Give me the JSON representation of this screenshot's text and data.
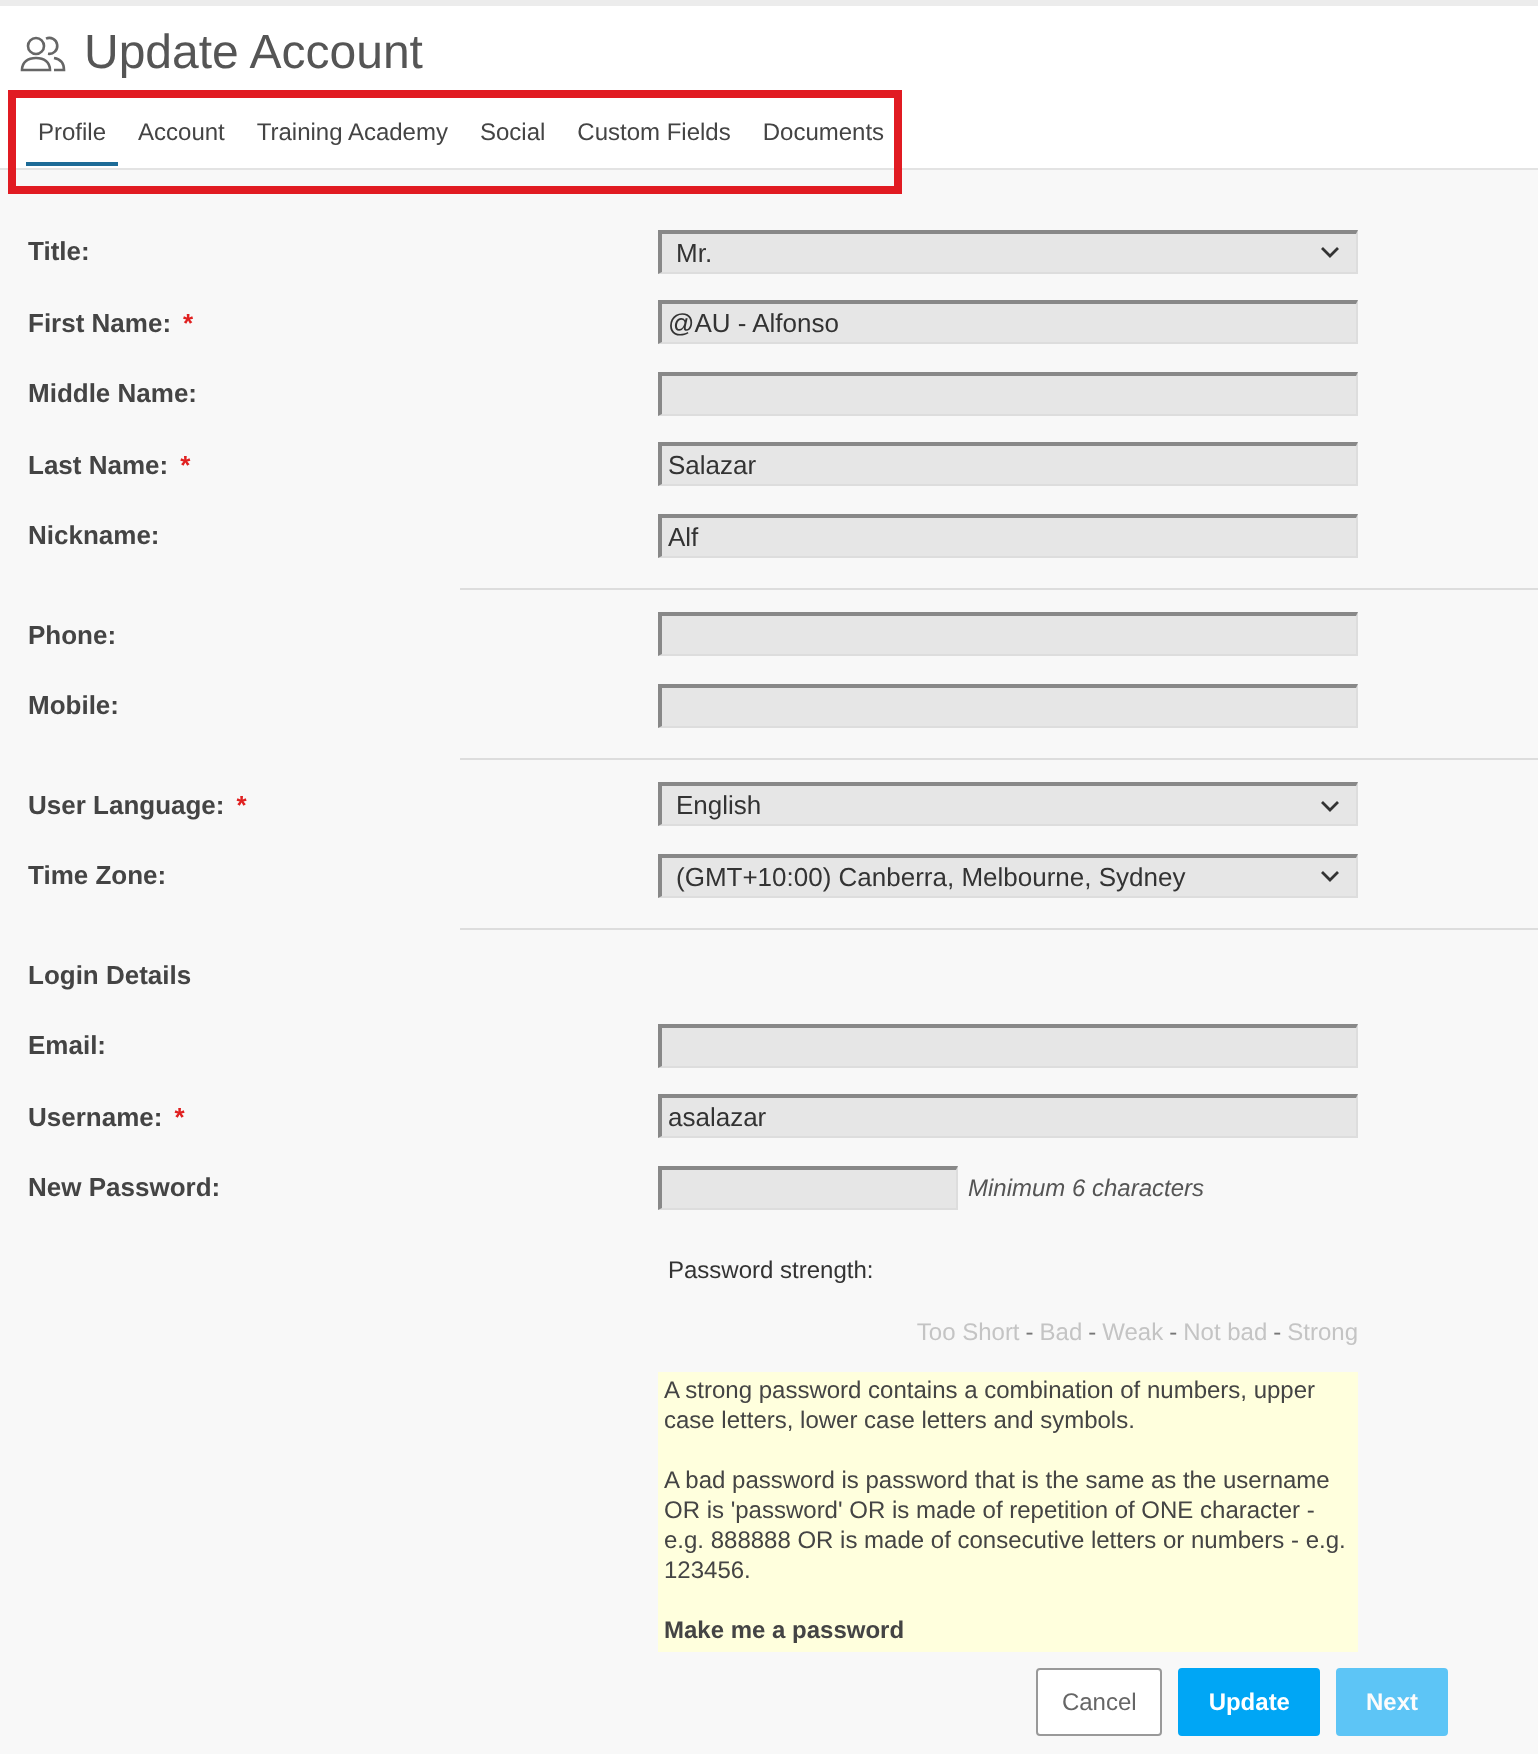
{
  "header": {
    "title": "Update Account"
  },
  "tabs": [
    {
      "label": "Profile",
      "selected": true
    },
    {
      "label": "Account",
      "selected": false
    },
    {
      "label": "Training Academy",
      "selected": false
    },
    {
      "label": "Social",
      "selected": false
    },
    {
      "label": "Custom Fields",
      "selected": false
    },
    {
      "label": "Documents",
      "selected": false
    }
  ],
  "sections": [
    {
      "fields": [
        {
          "label": "Title:",
          "kind": "select",
          "value": "Mr."
        },
        {
          "label": "First Name:",
          "required_mark": "*",
          "kind": "text",
          "value": "@AU - Alfonso"
        },
        {
          "label": "Middle Name:",
          "kind": "text"
        },
        {
          "label": "Last Name:",
          "required_mark": "*",
          "kind": "text",
          "value": "Salazar"
        },
        {
          "label": "Nickname:",
          "kind": "text",
          "value": "Alf"
        }
      ]
    },
    {
      "fields": [
        {
          "label": "Phone:",
          "kind": "text"
        },
        {
          "label": "Mobile:",
          "kind": "text"
        }
      ]
    },
    {
      "fields": [
        {
          "label": "User Language:",
          "required_mark": "*",
          "kind": "select",
          "value": "English"
        },
        {
          "label": "Time Zone:",
          "kind": "select",
          "value": "(GMT+10:00) Canberra, Melbourne, Sydney"
        }
      ]
    },
    {
      "heading": "Login Details",
      "fields": [
        {
          "label": "Email:",
          "kind": "text"
        },
        {
          "label": "Username:",
          "required_mark": "*",
          "kind": "text",
          "value": "asalazar"
        },
        {
          "label": "New Password:",
          "kind": "password",
          "hint": "Minimum 6 characters"
        }
      ]
    }
  ],
  "password_strength": {
    "label": "Password strength:",
    "levels": [
      "Too Short",
      "Bad",
      "Weak",
      "Not bad",
      "Strong"
    ],
    "separator": "-"
  },
  "info": {
    "paragraphs": [
      "A strong password contains a combination of numbers, upper case letters, lower case letters and symbols.",
      "A bad password is password that is the same as the username OR is 'password' OR is made of repetition of ONE character - e.g. 888888 OR is made of consecutive letters or numbers - e.g. 123456."
    ],
    "link": "Make me a password"
  },
  "buttons": [
    {
      "label": "Cancel",
      "kind": "default",
      "disabled": false
    },
    {
      "label": "Update",
      "kind": "primary",
      "disabled": false
    },
    {
      "label": "Next",
      "kind": "primary",
      "disabled": true
    }
  ]
}
